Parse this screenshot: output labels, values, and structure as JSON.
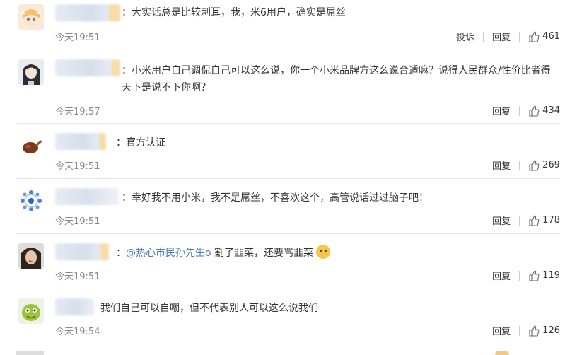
{
  "comments": [
    {
      "text": "：大实话总是比较刺耳，我，米6用户，确实是屌丝",
      "time": "今天19:51",
      "report": "投诉",
      "reply": "回复",
      "likes": "461",
      "avatar_icon": "cartoon-girl-avatar"
    },
    {
      "text": "：小米用户自己调侃自己可以这么说，你一个小米品牌方这么说合适嘛？说得人民群众/性价比者得天下是说不下你啊？",
      "time": "今天19:57",
      "reply": "回复",
      "likes": "434",
      "avatar_icon": "anime-man-avatar"
    },
    {
      "text": "：官方认证",
      "time": "今天19:51",
      "reply": "回复",
      "likes": "269",
      "avatar_icon": "roast-chicken-avatar"
    },
    {
      "text": "：幸好我不用小米，我不是屌丝，不喜欢这个，高管说话过过脑子吧！",
      "time": "今天19:51",
      "reply": "回复",
      "likes": "178",
      "avatar_icon": "blue-dots-pattern-avatar"
    },
    {
      "prefix": "：",
      "mention": "@热心市民孙先生o",
      "text": " 割了韭菜，还要骂韭菜",
      "time": "今天19:51",
      "reply": "回复",
      "likes": "119",
      "avatar_icon": "person-face-avatar"
    },
    {
      "text": "我们自己可以自嘲，但不代表别人可以这么说我们",
      "time": "今天19:54",
      "reply": "回复",
      "likes": "126",
      "avatar_icon": "green-cartoon-avatar"
    }
  ],
  "colors": {
    "mention": "#4a7eb8",
    "time": "#888888",
    "divider": "#e6e6e6"
  }
}
